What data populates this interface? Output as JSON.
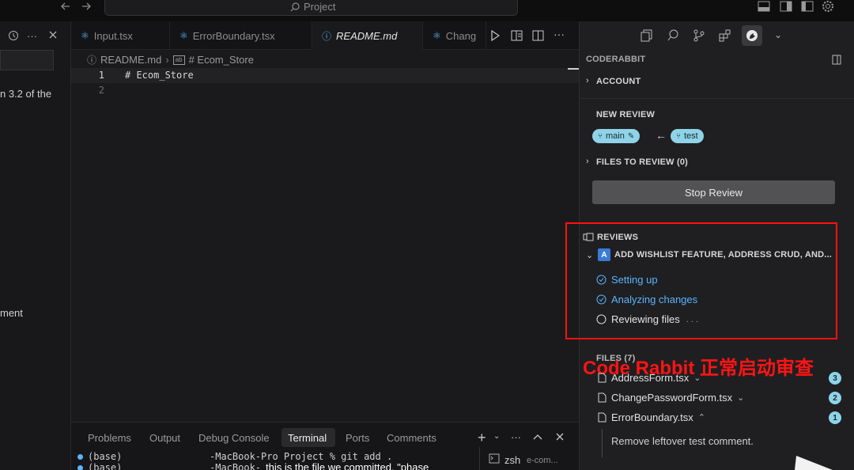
{
  "titlebar": {
    "search_placeholder": "Project"
  },
  "left_sidebar": {
    "text_fragment_1": "n 3.2 of the",
    "text_fragment_2": "ment"
  },
  "tabs": [
    {
      "label": "Input.tsx"
    },
    {
      "label": "ErrorBoundary.tsx"
    },
    {
      "label": "README.md"
    },
    {
      "label": "Chang"
    }
  ],
  "breadcrumb": {
    "file": "README.md",
    "symbol": "# Ecom_Store"
  },
  "code_lines": [
    {
      "number": "1",
      "text": "# Ecom_Store"
    },
    {
      "number": "2",
      "text": ""
    }
  ],
  "panel": {
    "tabs": [
      "Problems",
      "Output",
      "Debug Console",
      "Terminal",
      "Ports",
      "Comments"
    ],
    "active_tab": "Terminal",
    "terminal_lines": [
      {
        "prompt": "(base)",
        "text": "-MacBook-Pro Project % git add ."
      },
      {
        "prompt": "(base)",
        "text": "-MacBook-"
      }
    ],
    "shell_label": "zsh",
    "shell_name": "e-com..."
  },
  "coderabbit": {
    "title": "CODERABBIT",
    "account_label": "ACCOUNT",
    "new_review_label": "NEW REVIEW",
    "branch_base": "main",
    "branch_head": "test",
    "files_to_review_label": "FILES TO REVIEW (0)",
    "stop_review_label": "Stop Review",
    "reviews_label": "REVIEWS",
    "review_badge": "A",
    "review_title": "ADD WISHLIST FEATURE, ADDRESS CRUD, AND...",
    "steps": [
      {
        "label": "Setting up",
        "status": "done"
      },
      {
        "label": "Analyzing changes",
        "status": "done"
      },
      {
        "label": "Reviewing files",
        "status": "in-progress"
      }
    ],
    "reviewing_dots": ". . .",
    "files_label": "FILES (7)",
    "files": [
      {
        "name": "AddressForm.tsx",
        "count": "3",
        "expanded": false
      },
      {
        "name": "ChangePasswordForm.tsx",
        "count": "2",
        "expanded": false
      },
      {
        "name": "ErrorBoundary.tsx",
        "count": "1",
        "expanded": true
      }
    ],
    "comment_text": "Remove leftover test comment."
  },
  "annotation_text": "Code Rabbit 正常启动审查",
  "subtitle_text": "this is the file we committed. \"phase",
  "colors": {
    "accent_blue": "#5ab4ff",
    "pill_cyan": "#8fd3e8",
    "annotation_red": "#ff1414",
    "stop_button": "#525254"
  }
}
